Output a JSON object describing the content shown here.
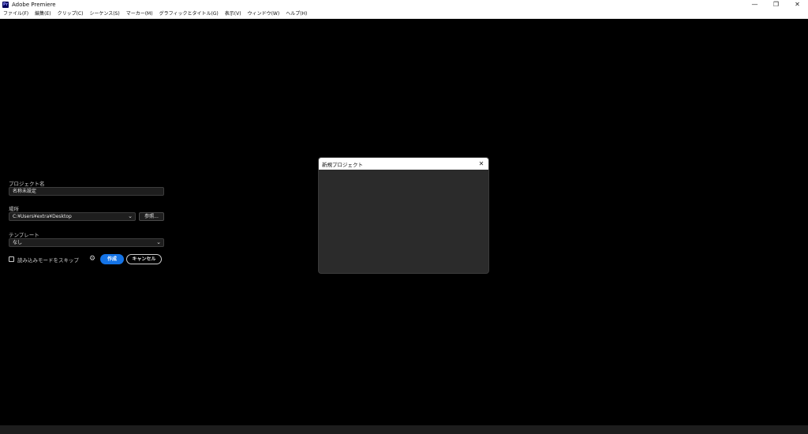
{
  "window": {
    "app_icon_text": "Pr",
    "title": "Adobe Premiere",
    "controls": {
      "minimize": "—",
      "restore": "❐",
      "close": "✕"
    }
  },
  "menubar": {
    "items": [
      "ファイル(F)",
      "編集(E)",
      "クリップ(C)",
      "シーケンス(S)",
      "マーカー(M)",
      "グラフィックとタイトル(G)",
      "表示(V)",
      "ウィンドウ(W)",
      "ヘルプ(H)"
    ]
  },
  "dialog": {
    "title": "新規プロジェクト",
    "close_glyph": "✕",
    "project_name": {
      "label": "プロジェクト名",
      "value": "名称未設定"
    },
    "location": {
      "label": "場所",
      "value": "C:¥Users¥extra¥Desktop",
      "browse_label": "参照..."
    },
    "template": {
      "label": "テンプレート",
      "value": "なし"
    },
    "skip_import": {
      "label": "読み込みモードをスキップ",
      "checked": false
    },
    "settings_icon": "gear-icon",
    "create_label": "作成",
    "cancel_label": "キャンセル",
    "accent_color": "#1473e6"
  }
}
